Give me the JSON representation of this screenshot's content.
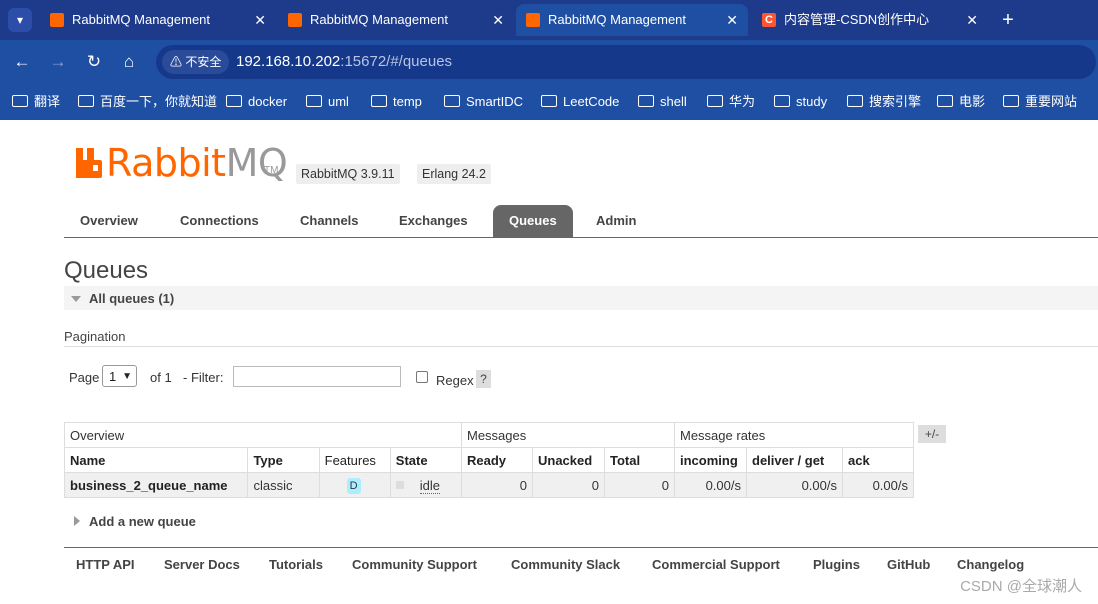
{
  "browser": {
    "tabs": [
      {
        "title": "RabbitMQ Management",
        "favicon": "rabbitmq-icon"
      },
      {
        "title": "RabbitMQ Management",
        "favicon": "rabbitmq-icon"
      },
      {
        "title": "RabbitMQ Management",
        "favicon": "rabbitmq-icon",
        "active": true
      },
      {
        "title": "内容管理-CSDN创作中心",
        "favicon": "csdn-icon",
        "favicon_letter": "C"
      }
    ],
    "close_glyph": "✕",
    "new_tab_glyph": "+",
    "security_label": "不安全",
    "url_host": "192.168.10.202",
    "url_rest": ":15672/#/queues",
    "bookmarks": [
      "翻译",
      "百度一下，你就知道",
      "docker",
      "uml",
      "temp",
      "SmartIDC",
      "LeetCode",
      "shell",
      "华为",
      "study",
      "搜索引擎",
      "电影",
      "重要网站"
    ]
  },
  "app": {
    "logo_brand": "Rabbit",
    "logo_suffix": "MQ",
    "logo_tm": "TM",
    "rabbitmq_version": "RabbitMQ 3.9.11",
    "erlang_version": "Erlang 24.2",
    "nav": [
      "Overview",
      "Connections",
      "Channels",
      "Exchanges",
      "Queues",
      "Admin"
    ],
    "active_nav": "Queues",
    "page_title": "Queues",
    "section_label": "All queues (1)",
    "pagination": {
      "title": "Pagination",
      "page_label": "Page",
      "page_value": "1",
      "of_label": "of 1",
      "filter_label": "- Filter:",
      "filter_value": "",
      "regex_label": "Regex",
      "help_label": "?"
    },
    "table": {
      "group_headers": [
        "Overview",
        "Messages",
        "Message rates"
      ],
      "columns": [
        "Name",
        "Type",
        "Features",
        "State",
        "Ready",
        "Unacked",
        "Total",
        "incoming",
        "deliver / get",
        "ack"
      ],
      "rows": [
        {
          "name": "business_2_queue_name",
          "type": "classic",
          "features": "D",
          "state": "idle",
          "ready": "0",
          "unacked": "0",
          "total": "0",
          "incoming": "0.00/s",
          "deliver_get": "0.00/s",
          "ack": "0.00/s"
        }
      ],
      "column_toggle": "+/-"
    },
    "add_queue_label": "Add a new queue",
    "footer_links": [
      "HTTP API",
      "Server Docs",
      "Tutorials",
      "Community Support",
      "Community Slack",
      "Commercial Support",
      "Plugins",
      "GitHub",
      "Changelog"
    ],
    "watermark": "CSDN @全球潮人"
  },
  "colors": {
    "brand_orange": "#ff6600",
    "browser_blue": "#1f4fa3",
    "feature_badge": "#aaeeff"
  }
}
